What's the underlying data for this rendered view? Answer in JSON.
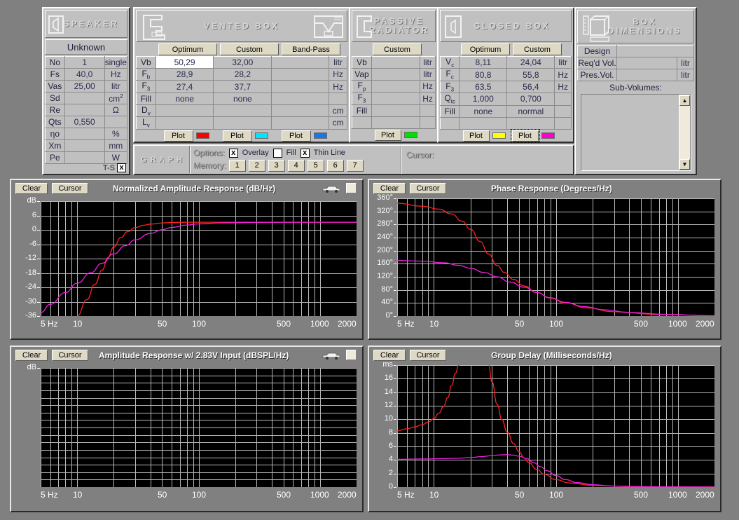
{
  "speaker": {
    "title": "SPEAKER",
    "name": "Unknown",
    "no_label": "No",
    "no_value": "1",
    "config": "single",
    "rows": [
      {
        "label": "Fs",
        "value": "40,0",
        "unit": "Hz"
      },
      {
        "label": "Vas",
        "value": "25,00",
        "unit": "litr"
      },
      {
        "label": "Sd",
        "value": "",
        "unit": "cm2"
      },
      {
        "label": "Re",
        "value": "",
        "unit": "Ω"
      },
      {
        "label": "Qts",
        "value": "0,550",
        "unit": ""
      },
      {
        "label": "ηo",
        "value": "",
        "unit": "%"
      },
      {
        "label": "Xm",
        "value": "",
        "unit": "mm"
      },
      {
        "label": "Pe",
        "value": "",
        "unit": "W"
      }
    ],
    "ts_label": "T-S",
    "ts_checked": "x"
  },
  "vented": {
    "title": "VENTED BOX",
    "columns": [
      "Optimum",
      "Custom",
      "Band-Pass"
    ],
    "rows": [
      {
        "label": "Vb",
        "values": [
          "50,29",
          "32,00",
          ""
        ],
        "unit": "litr"
      },
      {
        "label": "Fb",
        "values": [
          "28,9",
          "28,2",
          ""
        ],
        "unit": "Hz"
      },
      {
        "label": "F3",
        "values": [
          "27,4",
          "37,7",
          ""
        ],
        "unit": "Hz"
      },
      {
        "label": "Fill",
        "values": [
          "none",
          "none",
          ""
        ],
        "unit": ""
      },
      {
        "label": "Dv",
        "values": [
          "",
          "",
          ""
        ],
        "unit": "cm"
      },
      {
        "label": "Lv",
        "values": [
          "",
          "",
          ""
        ],
        "unit": "cm"
      }
    ],
    "plot_label": "Plot",
    "plot_colors": [
      "#ff0000",
      "#00e5ff",
      "#1577e8"
    ]
  },
  "passive": {
    "title_line1": "PASSIVE",
    "title_line2": "RADIATOR",
    "columns": [
      "Custom"
    ],
    "rows": [
      {
        "label": "Vb",
        "values": [
          ""
        ],
        "unit": "litr"
      },
      {
        "label": "Vap",
        "values": [
          ""
        ],
        "unit": "litr"
      },
      {
        "label": "Fp",
        "values": [
          ""
        ],
        "unit": "Hz"
      },
      {
        "label": "F3",
        "values": [
          ""
        ],
        "unit": "Hz"
      },
      {
        "label": "Fill",
        "values": [
          ""
        ],
        "unit": ""
      },
      {
        "label": "",
        "values": [
          ""
        ],
        "unit": ""
      }
    ],
    "plot_label": "Plot",
    "plot_colors": [
      "#00e000"
    ]
  },
  "closed": {
    "title": "CLOSED BOX",
    "columns": [
      "Optimum",
      "Custom"
    ],
    "rows": [
      {
        "label": "Vc",
        "values": [
          "8,11",
          "24,04"
        ],
        "unit": "litr"
      },
      {
        "label": "Fc",
        "values": [
          "80,8",
          "55,8"
        ],
        "unit": "Hz"
      },
      {
        "label": "F3",
        "values": [
          "63,5",
          "56,4"
        ],
        "unit": "Hz"
      },
      {
        "label": "Qtc",
        "values": [
          "1,000",
          "0,700"
        ],
        "unit": ""
      },
      {
        "label": "Fill",
        "values": [
          "none",
          "normal"
        ],
        "unit": ""
      },
      {
        "label": "",
        "values": [
          "",
          ""
        ],
        "unit": ""
      }
    ],
    "plot_label": "Plot",
    "plot_colors": [
      "#ffff00",
      "#ff00cc"
    ]
  },
  "boxdim": {
    "title_line1": "BOX",
    "title_line2": "DIMENSIONS",
    "design_label": "Design",
    "design_value": "",
    "reqd_label": "Req'd Vol.",
    "reqd_value": "",
    "reqd_unit": "litr",
    "pres_label": "Pres.Vol.",
    "pres_value": "",
    "pres_unit": "litr",
    "subvol_label": "Sub-Volumes:"
  },
  "graphbar": {
    "title": "G R A P H",
    "options_label": "Options:",
    "memory_label": "Memory:",
    "cursor_label": "Cursor:",
    "cursor_value": "",
    "options": [
      {
        "label": "Overlay",
        "checked": true
      },
      {
        "label": "Fill",
        "checked": false
      },
      {
        "label": "Thin Line",
        "checked": true
      }
    ],
    "memory_buttons": [
      "1",
      "2",
      "3",
      "4",
      "5",
      "6",
      "7"
    ]
  },
  "graphs": {
    "clear_label": "Clear",
    "cursor_label": "Cursor",
    "xticks": [
      "5 Hz",
      "10",
      "50",
      "100",
      "500",
      "1000",
      "2000"
    ]
  },
  "chart_data": [
    {
      "type": "line",
      "title": "Normalized Amplitude Response (dB/Hz)",
      "xlabel": "Hz",
      "ylabel": "dB",
      "xscale": "log",
      "xlim": [
        5,
        2000
      ],
      "grid": true,
      "yticks": [
        "dB",
        "6",
        "0",
        "-6",
        "-12",
        "-18",
        "-24",
        "-30",
        "-36"
      ],
      "ylim": [
        -40,
        9
      ],
      "xticks": [
        "5 Hz",
        "10",
        "50",
        "100",
        "500",
        "1000",
        "2000"
      ],
      "series": [
        {
          "name": "vented-optimum",
          "color": "#ff2020",
          "x": [
            10,
            12,
            14,
            16,
            18,
            20,
            23,
            26,
            30,
            35,
            40,
            50,
            60,
            80,
            100,
            200,
            500,
            2000
          ],
          "values": [
            -40,
            -33,
            -26.5,
            -20.5,
            -15,
            -10.5,
            -6.5,
            -4,
            -2.3,
            -1.3,
            -0.8,
            -0.3,
            -0.1,
            0,
            0,
            0,
            0,
            0
          ]
        },
        {
          "name": "closed-custom",
          "color": "#ee22dd",
          "x": [
            5,
            6,
            8,
            10,
            13,
            16,
            20,
            25,
            30,
            40,
            50,
            60,
            80,
            100,
            150,
            300,
            800,
            2000
          ],
          "values": [
            -38.5,
            -35,
            -30,
            -26,
            -21.5,
            -17.5,
            -13.5,
            -10,
            -7.5,
            -4.8,
            -3.2,
            -2.2,
            -1.2,
            -0.7,
            -0.3,
            -0.05,
            0,
            0
          ]
        }
      ]
    },
    {
      "type": "line",
      "title": "Phase Response (Degrees/Hz)",
      "xlabel": "Hz",
      "ylabel": "Degrees",
      "xscale": "log",
      "xlim": [
        5,
        2000
      ],
      "grid": true,
      "yticks": [
        "360°",
        "320°",
        "280°",
        "240°",
        "200°",
        "160°",
        "120°",
        "80°",
        "40°",
        "0°"
      ],
      "ylim": [
        0,
        360
      ],
      "xticks": [
        "5 Hz",
        "10",
        "50",
        "100",
        "500",
        "1000",
        "2000"
      ],
      "series": [
        {
          "name": "vented-optimum",
          "color": "#ff2020",
          "x": [
            5,
            8,
            11,
            14,
            17,
            20,
            24,
            28,
            33,
            38,
            45,
            55,
            70,
            90,
            120,
            180,
            300,
            700,
            2000
          ],
          "values": [
            345,
            336,
            327,
            312,
            290,
            265,
            228,
            190,
            155,
            133,
            112,
            92,
            72,
            55,
            40,
            25,
            13,
            5,
            1
          ]
        },
        {
          "name": "closed-custom",
          "color": "#ee22dd",
          "x": [
            5,
            8,
            12,
            16,
            20,
            26,
            33,
            42,
            55,
            70,
            90,
            120,
            170,
            250,
            400,
            800,
            2000
          ],
          "values": [
            170,
            168,
            163,
            155,
            146,
            133,
            120,
            104,
            88,
            72,
            56,
            42,
            29,
            19,
            11,
            5,
            1
          ]
        }
      ]
    },
    {
      "type": "line",
      "title": "Amplitude Response w/ 2.83V Input (dBSPL/Hz)",
      "xlabel": "Hz",
      "ylabel": "dB",
      "xscale": "log",
      "xlim": [
        5,
        2000
      ],
      "grid": true,
      "yticks": [
        "dB"
      ],
      "xticks": [
        "5 Hz",
        "10",
        "50",
        "100",
        "500",
        "1000",
        "2000"
      ],
      "series": []
    },
    {
      "type": "line",
      "title": "Group Delay (Milliseconds/Hz)",
      "xlabel": "Hz",
      "ylabel": "ms",
      "xscale": "log",
      "xlim": [
        5,
        2000
      ],
      "grid": true,
      "yticks": [
        "ms",
        "16",
        "14",
        "12",
        "10",
        "8",
        "6",
        "4",
        "2",
        "0"
      ],
      "ylim": [
        0,
        18
      ],
      "xticks": [
        "5 Hz",
        "10",
        "50",
        "100",
        "500",
        "1000",
        "2000"
      ],
      "series": [
        {
          "name": "vented-optimum-left",
          "color": "#ff2020",
          "x": [
            5,
            6,
            7,
            8,
            9,
            10,
            11,
            12,
            13,
            14,
            15,
            16,
            17
          ],
          "values": [
            8.3,
            8.6,
            8.9,
            9.2,
            9.6,
            10.1,
            10.9,
            11.9,
            13.2,
            15,
            16.8,
            18,
            18.2
          ]
        },
        {
          "name": "vented-optimum-right",
          "color": "#ff2020",
          "x": [
            28,
            30,
            33,
            36,
            40,
            45,
            50,
            55,
            60,
            70,
            80,
            100,
            130,
            200,
            400,
            1000,
            2000
          ],
          "values": [
            18.2,
            15.5,
            12.2,
            10,
            8.1,
            6.4,
            5.2,
            4.3,
            3.6,
            2.6,
            1.9,
            1.1,
            0.6,
            0.25,
            0.08,
            0.02,
            0.01
          ]
        },
        {
          "name": "closed-custom",
          "color": "#ee22dd",
          "x": [
            5,
            8,
            12,
            16,
            20,
            25,
            30,
            35,
            40,
            45,
            50,
            58,
            66,
            75,
            85,
            100,
            120,
            150,
            200,
            300,
            600,
            2000
          ],
          "values": [
            4.1,
            4.15,
            4.2,
            4.25,
            4.35,
            4.5,
            4.65,
            4.75,
            4.78,
            4.72,
            4.55,
            4.2,
            3.6,
            3.0,
            2.4,
            1.7,
            1.1,
            0.65,
            0.35,
            0.15,
            0.04,
            0.01
          ]
        }
      ]
    }
  ]
}
